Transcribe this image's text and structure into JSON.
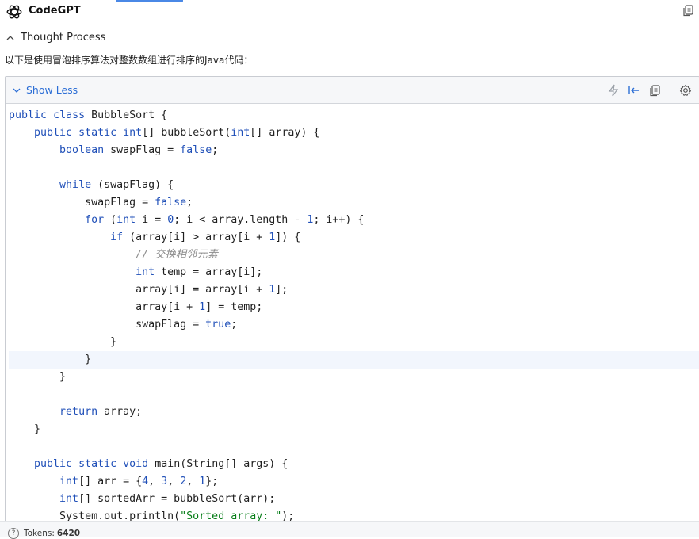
{
  "app": {
    "title": "CodeGPT"
  },
  "thought": {
    "label": "Thought Process"
  },
  "intro": {
    "text": "以下是使用冒泡排序算法对整数数组进行排序的Java代码："
  },
  "code_card": {
    "toggle_label": "Show Less",
    "icons": [
      "lightning-icon",
      "insert-left-icon",
      "copy-icon",
      "settings-icon"
    ]
  },
  "code_lines": [
    "public class BubbleSort {",
    "    public static int[] bubbleSort(int[] array) {",
    "        boolean swapFlag = false;",
    "",
    "        while (swapFlag) {",
    "            swapFlag = false;",
    "            for (int i = 0; i < array.length - 1; i++) {",
    "                if (array[i] > array[i + 1]) {",
    "                    // 交换相邻元素",
    "                    int temp = array[i];",
    "                    array[i] = array[i + 1];",
    "                    array[i + 1] = temp;",
    "                    swapFlag = true;",
    "                }",
    "            }",
    "        }",
    "",
    "        return array;",
    "    }",
    "",
    "    public static void main(String[] args) {",
    "        int[] arr = {4, 3, 2, 1};",
    "        int[] sortedArr = bubbleSort(arr);",
    "        System.out.println(\"Sorted array: \");"
  ],
  "highlighted_line": 14,
  "footer": {
    "tokens_label": "Tokens:",
    "tokens_value": "6420"
  },
  "colors": {
    "accent": "#2d6fd6",
    "keyword": "#1f4fb8",
    "string": "#067d17",
    "comment": "#8c8c8c"
  }
}
